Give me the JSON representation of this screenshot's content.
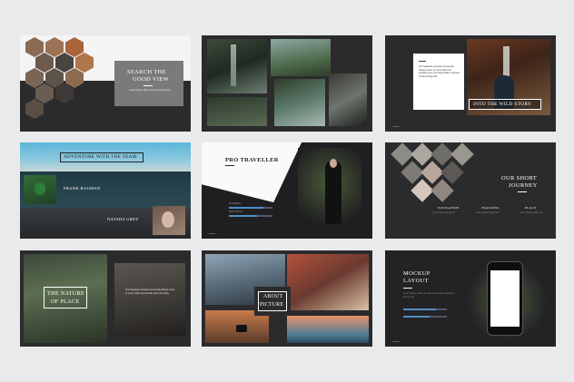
{
  "slides": {
    "s1": {
      "title_line1": "SEARCH THE",
      "title_line2": "GOOD VIEW",
      "body": "Lorem ipsum dolor sit amet consectetur"
    },
    "s2": {},
    "s3": {
      "quote": "Our happiest moments as tourists always seem to come when we stumble upon one thing while in pursuit of something else",
      "title": "INTO THE WILD STORY"
    },
    "s4": {
      "title": "ADVENTURE WITH THE TEAM",
      "person1": "FRANK BAUMAN",
      "person2": "NATSHA GREY"
    },
    "s5": {
      "title": "PRO TRAVELLER",
      "bar1_label": "PLANNING",
      "bar2_label": "EXPLORING",
      "bar1_pct": 80,
      "bar2_pct": 65
    },
    "s6": {
      "title_line1": "OUR SHORT",
      "title_line2": "JOURNEY",
      "label1": "NAVIGATION",
      "label2": "TRACKING",
      "label3": "PLACE"
    },
    "s7": {
      "title_line1": "THE NATURE",
      "title_line2": "OF PLACE",
      "quote": "Our happiest moments as tourists always seem to come when we stumble upon one thing"
    },
    "s8": {
      "title_line1": "ABOUT",
      "title_line2": "PICTURE"
    },
    "s9": {
      "title_line1": "MOCKUP",
      "title_line2": "LAYOUT",
      "bar1_pct": 75,
      "bar2_pct": 60
    }
  },
  "colors": {
    "bg": "#e9eaec",
    "slide": "#2b2b2d",
    "accent": "#4f8ec4"
  }
}
